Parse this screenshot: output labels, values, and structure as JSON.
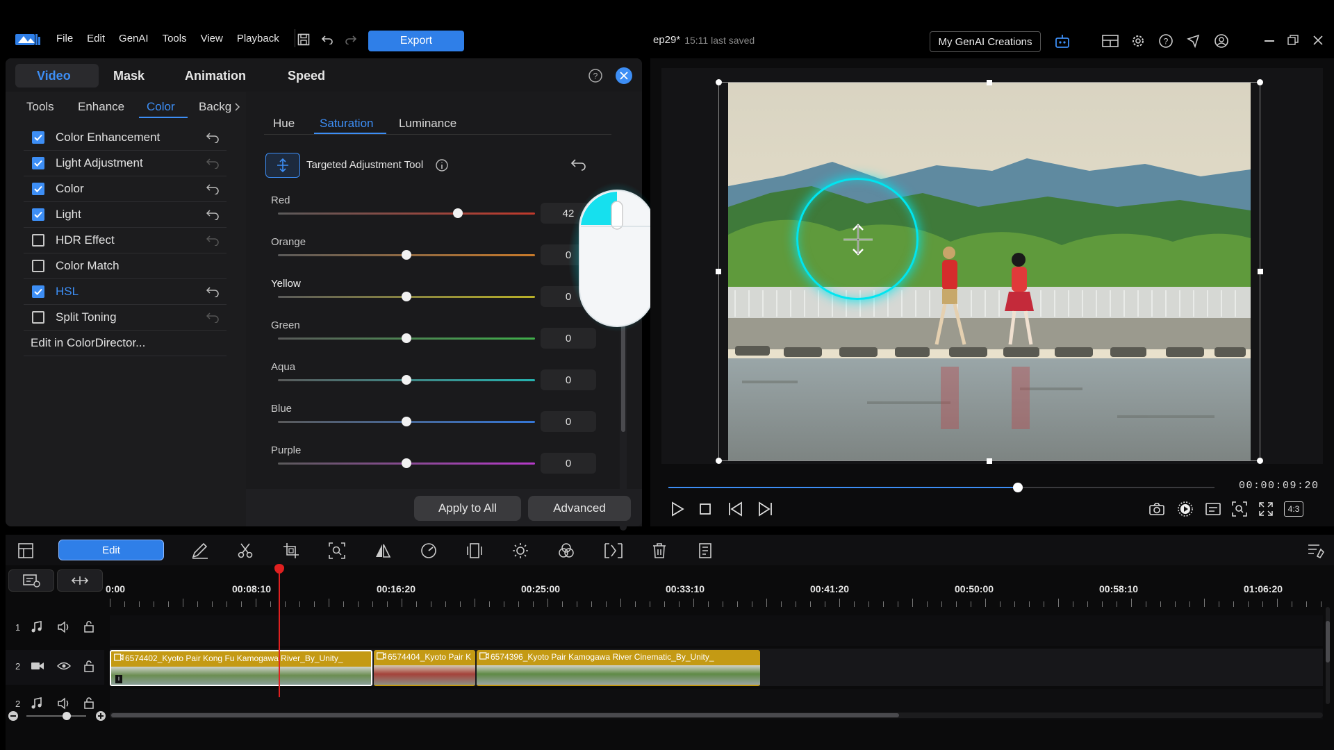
{
  "app": {
    "menu": [
      "File",
      "Edit",
      "GenAI",
      "Tools",
      "View",
      "Playback"
    ],
    "export_label": "Export",
    "project_title": "ep29*",
    "saved_status": "15:11 last saved",
    "genai_button": "My GenAI Creations"
  },
  "panel": {
    "tabs": [
      "Video",
      "Mask",
      "Animation",
      "Speed"
    ],
    "active_tab": "Video",
    "subtabs": [
      "Tools",
      "Enhance",
      "Color",
      "Backg"
    ],
    "active_subtab": "Color",
    "categories": [
      {
        "label": "Color Enhancement",
        "checked": true
      },
      {
        "label": "Light Adjustment",
        "checked": true
      },
      {
        "label": "Color",
        "checked": true
      },
      {
        "label": "Light",
        "checked": true
      },
      {
        "label": "HDR Effect",
        "checked": false
      },
      {
        "label": "Color Match",
        "checked": false
      },
      {
        "label": "HSL",
        "checked": true
      },
      {
        "label": "Split Toning",
        "checked": false
      }
    ],
    "edit_in_colordirector": "Edit in ColorDirector...",
    "hsl_tabs": [
      "Hue",
      "Saturation",
      "Luminance"
    ],
    "active_hsl_tab": "Saturation",
    "targeted_tool_label": "Targeted Adjustment Tool",
    "sliders": [
      {
        "label": "Red",
        "value": "42",
        "fraction": 0.7,
        "color": "#c0392b"
      },
      {
        "label": "Orange",
        "value": "0",
        "fraction": 0.5,
        "color": "#c87a2a"
      },
      {
        "label": "Yellow",
        "value": "0",
        "fraction": 0.5,
        "color": "#b9b028"
      },
      {
        "label": "Green",
        "value": "0",
        "fraction": 0.5,
        "color": "#3fae4a"
      },
      {
        "label": "Aqua",
        "value": "0",
        "fraction": 0.5,
        "color": "#26b3b0"
      },
      {
        "label": "Blue",
        "value": "0",
        "fraction": 0.5,
        "color": "#3576d6"
      },
      {
        "label": "Purple",
        "value": "0",
        "fraction": 0.5,
        "color": "#b53ac9"
      }
    ],
    "apply_all_label": "Apply to All",
    "advanced_label": "Advanced"
  },
  "preview": {
    "timecode": "00:00:09:20",
    "progress": 0.64,
    "aspect_label": "4:3"
  },
  "timeline": {
    "edit_label": "Edit",
    "ruler": [
      "0:00",
      "00:08:10",
      "00:16:20",
      "00:25:00",
      "00:33:10",
      "00:41:20",
      "00:50:00",
      "00:58:10",
      "01:06:20"
    ],
    "tracks": [
      "1",
      "2",
      "2"
    ],
    "clips": [
      {
        "title": "6574402_Kyoto Pair Kong Fu Kamogawa River_By_Unity_"
      },
      {
        "title": "6574404_Kyoto Pair K"
      },
      {
        "title": "6574396_Kyoto Pair Kamogawa River Cinematic_By_Unity_"
      }
    ]
  },
  "colors": {
    "accent": "#3d8ef5",
    "clip": "#c49a14",
    "playhead": "#e02020",
    "cyan": "#00e5f0"
  }
}
